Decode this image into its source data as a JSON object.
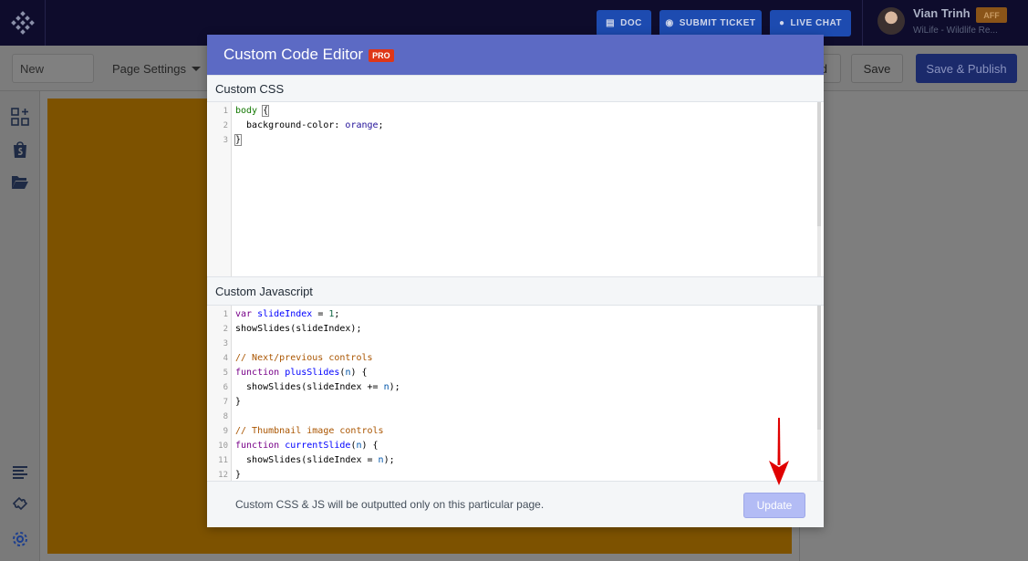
{
  "topbar": {
    "buttons": [
      {
        "label": "DOC",
        "icon": "document-icon"
      },
      {
        "label": "SUBMIT TICKET",
        "icon": "lifebuoy-icon"
      },
      {
        "label": "LIVE CHAT",
        "icon": "chat-icon"
      }
    ],
    "user": {
      "name": "Vian Trinh",
      "badge": "AFF",
      "store": "WiLife - Wildlife Re..."
    }
  },
  "subbar": {
    "page_name": "New",
    "page_settings_label": "Page Settings",
    "preview_partial": "d",
    "save_label": "Save",
    "publish_label": "Save & Publish"
  },
  "sidebar": {
    "icons": [
      "add-element-icon",
      "shopify-bag-icon",
      "folder-open-icon",
      "list-icon",
      "puzzle-icon",
      "gear-icon"
    ]
  },
  "modal": {
    "title": "Custom Code Editor",
    "badge": "PRO",
    "css_label": "Custom CSS",
    "js_label": "Custom Javascript",
    "css_lines": [
      "body {",
      "  background-color: orange;",
      "}"
    ],
    "js_lines": [
      "var slideIndex = 1;",
      "showSlides(slideIndex);",
      "",
      "// Next/previous controls",
      "function plusSlides(n) {",
      "  showSlides(slideIndex += n);",
      "}",
      "",
      "// Thumbnail image controls",
      "function currentSlide(n) {",
      "  showSlides(slideIndex = n);",
      "}"
    ],
    "footer_note": "Custom CSS & JS will be outputted only on this particular page.",
    "update_label": "Update"
  },
  "colors": {
    "modal_header": "#5c6ac4",
    "pro_badge": "#de3618",
    "update_button": "#b3bcf5",
    "canvas": "#7d5200",
    "annotation_arrow": "#e00000"
  }
}
